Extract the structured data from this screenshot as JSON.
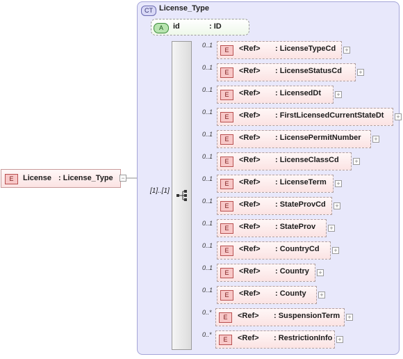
{
  "complex_type": {
    "badge": "CT",
    "name": "License_Type"
  },
  "attribute": {
    "badge": "A",
    "name": "id",
    "type": ": ID"
  },
  "root": {
    "badge": "E",
    "name": "License",
    "type": ": License_Type",
    "expand_symbol": "−"
  },
  "sequence": {
    "multiplicity": "[1]..[1]"
  },
  "children": [
    {
      "badge": "E",
      "ref": "<Ref>",
      "name": ": LicenseTypeCd",
      "mult": "0..1"
    },
    {
      "badge": "E",
      "ref": "<Ref>",
      "name": ": LicenseStatusCd",
      "mult": "0..1"
    },
    {
      "badge": "E",
      "ref": "<Ref>",
      "name": ": LicensedDt",
      "mult": "0..1"
    },
    {
      "badge": "E",
      "ref": "<Ref>",
      "name": ": FirstLicensedCurrentStateDt",
      "mult": "0..1"
    },
    {
      "badge": "E",
      "ref": "<Ref>",
      "name": ": LicensePermitNumber",
      "mult": "0..1"
    },
    {
      "badge": "E",
      "ref": "<Ref>",
      "name": ": LicenseClassCd",
      "mult": "0..1"
    },
    {
      "badge": "E",
      "ref": "<Ref>",
      "name": ": LicenseTerm",
      "mult": "0..1"
    },
    {
      "badge": "E",
      "ref": "<Ref>",
      "name": ": StateProvCd",
      "mult": "0..1"
    },
    {
      "badge": "E",
      "ref": "<Ref>",
      "name": ": StateProv",
      "mult": "0..1"
    },
    {
      "badge": "E",
      "ref": "<Ref>",
      "name": ": CountryCd",
      "mult": "0..1"
    },
    {
      "badge": "E",
      "ref": "<Ref>",
      "name": ": Country",
      "mult": "0..1"
    },
    {
      "badge": "E",
      "ref": "<Ref>",
      "name": ": County",
      "mult": "0..1"
    },
    {
      "badge": "E",
      "ref": "<Ref>",
      "name": ": SuspensionTerm",
      "mult": "0..*"
    },
    {
      "badge": "E",
      "ref": "<Ref>",
      "name": ": RestrictionInfo",
      "mult": "0..*"
    }
  ],
  "expand_symbol": "+"
}
